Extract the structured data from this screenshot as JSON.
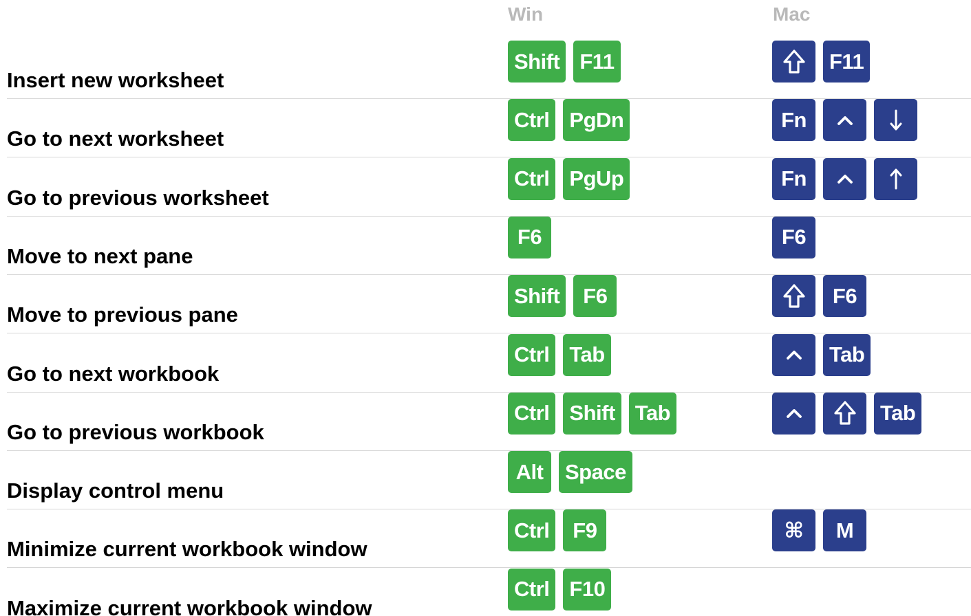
{
  "headers": {
    "win": "Win",
    "mac": "Mac"
  },
  "colors": {
    "win_key": "#3fae49",
    "mac_key": "#2b3f8c",
    "header_text": "#b9b9b9"
  },
  "rows": [
    {
      "label": "Insert new worksheet",
      "win": [
        {
          "text": "Shift"
        },
        {
          "text": "F11"
        }
      ],
      "mac": [
        {
          "icon": "shift-icon"
        },
        {
          "text": "F11"
        }
      ]
    },
    {
      "label": "Go to next worksheet",
      "win": [
        {
          "text": "Ctrl"
        },
        {
          "text": "PgDn"
        }
      ],
      "mac": [
        {
          "text": "Fn"
        },
        {
          "icon": "control-icon"
        },
        {
          "icon": "arrow-down-icon"
        }
      ]
    },
    {
      "label": "Go to previous worksheet",
      "win": [
        {
          "text": "Ctrl"
        },
        {
          "text": "PgUp"
        }
      ],
      "mac": [
        {
          "text": "Fn"
        },
        {
          "icon": "control-icon"
        },
        {
          "icon": "arrow-up-icon"
        }
      ]
    },
    {
      "label": "Move to next pane",
      "win": [
        {
          "text": "F6"
        }
      ],
      "mac": [
        {
          "text": "F6"
        }
      ]
    },
    {
      "label": "Move to previous pane",
      "win": [
        {
          "text": "Shift"
        },
        {
          "text": "F6"
        }
      ],
      "mac": [
        {
          "icon": "shift-icon"
        },
        {
          "text": "F6"
        }
      ]
    },
    {
      "label": "Go to next workbook",
      "win": [
        {
          "text": "Ctrl"
        },
        {
          "text": "Tab"
        }
      ],
      "mac": [
        {
          "icon": "control-icon"
        },
        {
          "text": "Tab"
        }
      ]
    },
    {
      "label": "Go to previous workbook",
      "win": [
        {
          "text": "Ctrl"
        },
        {
          "text": "Shift"
        },
        {
          "text": "Tab"
        }
      ],
      "mac": [
        {
          "icon": "control-icon"
        },
        {
          "icon": "shift-icon"
        },
        {
          "text": "Tab"
        }
      ]
    },
    {
      "label": "Display control menu",
      "win": [
        {
          "text": "Alt"
        },
        {
          "text": "Space"
        }
      ],
      "mac": []
    },
    {
      "label": "Minimize current workbook window",
      "win": [
        {
          "text": "Ctrl"
        },
        {
          "text": "F9"
        }
      ],
      "mac": [
        {
          "text": "⌘"
        },
        {
          "text": "M"
        }
      ]
    },
    {
      "label": "Maximize current workbook window",
      "win": [
        {
          "text": "Ctrl"
        },
        {
          "text": "F10"
        }
      ],
      "mac": []
    }
  ]
}
